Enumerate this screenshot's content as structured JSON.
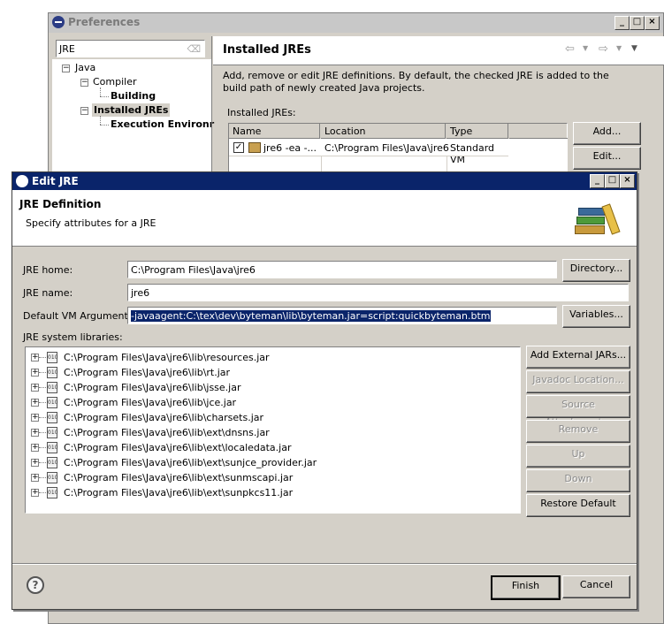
{
  "preferences": {
    "title": "Preferences",
    "filter_value": "JRE",
    "tree": [
      {
        "label": "Java"
      },
      {
        "label": "Compiler"
      },
      {
        "label": "Building"
      },
      {
        "label": "Installed JREs"
      },
      {
        "label": "Execution Environr"
      }
    ],
    "page_title": "Installed JREs",
    "description": "Add, remove or edit JRE definitions. By default, the checked JRE is added to the build path of newly created Java projects.",
    "table_label": "Installed JREs:",
    "columns": [
      "Name",
      "Location",
      "Type"
    ],
    "rows": [
      {
        "name": "jre6 -ea -...",
        "location": "C:\\Program Files\\Java\\jre6",
        "type": "Standard VM"
      }
    ],
    "buttons": {
      "add": "Add...",
      "edit": "Edit..."
    }
  },
  "edit_jre": {
    "title": "Edit JRE",
    "header_title": "JRE Definition",
    "header_subtitle": "Specify attributes for a JRE",
    "jre_home_label": "JRE home:",
    "jre_home_value": "C:\\Program Files\\Java\\jre6",
    "jre_name_label": "JRE name:",
    "jre_name_value": "jre6",
    "vm_args_label": "Default VM Arguments:",
    "vm_args_value": "-javaagent:C:\\tex\\dev\\byteman\\lib\\byteman.jar=script:quickbyteman.btm",
    "libraries_label": "JRE system libraries:",
    "libraries": [
      "C:\\Program Files\\Java\\jre6\\lib\\resources.jar",
      "C:\\Program Files\\Java\\jre6\\lib\\rt.jar",
      "C:\\Program Files\\Java\\jre6\\lib\\jsse.jar",
      "C:\\Program Files\\Java\\jre6\\lib\\jce.jar",
      "C:\\Program Files\\Java\\jre6\\lib\\charsets.jar",
      "C:\\Program Files\\Java\\jre6\\lib\\ext\\dnsns.jar",
      "C:\\Program Files\\Java\\jre6\\lib\\ext\\localedata.jar",
      "C:\\Program Files\\Java\\jre6\\lib\\ext\\sunjce_provider.jar",
      "C:\\Program Files\\Java\\jre6\\lib\\ext\\sunmscapi.jar",
      "C:\\Program Files\\Java\\jre6\\lib\\ext\\sunpkcs11.jar"
    ],
    "buttons": {
      "directory": "Directory...",
      "variables": "Variables...",
      "add_external_jars": "Add External JARs...",
      "javadoc_location": "Javadoc Location...",
      "source_attachment": "Source Attachment...",
      "remove": "Remove",
      "up": "Up",
      "down": "Down",
      "restore_default": "Restore Default",
      "finish": "Finish",
      "cancel": "Cancel"
    },
    "jar_icon_text": "010"
  }
}
